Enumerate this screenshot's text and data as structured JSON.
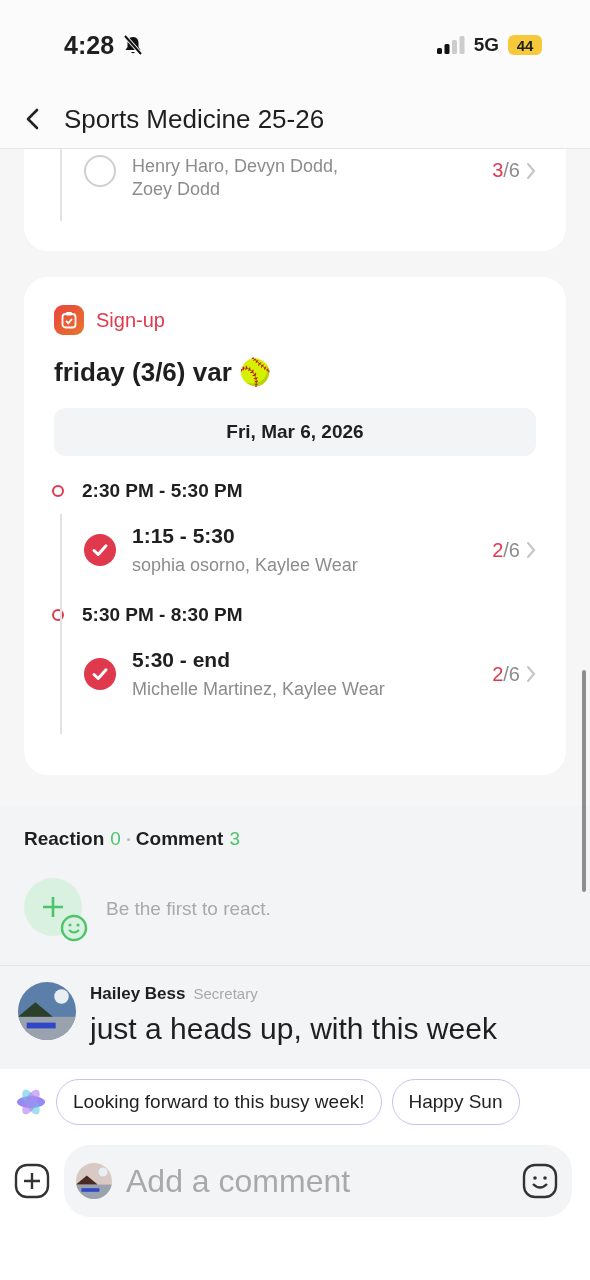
{
  "status_bar": {
    "time": "4:28",
    "network": "5G",
    "battery": "44"
  },
  "header": {
    "title": "Sports Medicine 25-26"
  },
  "previous_card": {
    "slots": [
      {
        "names": "Henry Haro, Devyn Dodd, Zoey Dodd",
        "filled": "3",
        "total": "/6",
        "checked": false
      }
    ]
  },
  "signup_card": {
    "label": "Sign-up",
    "title": "friday (3/6) var 🥎",
    "date": "Fri, Mar 6, 2026",
    "shifts": [
      {
        "time": "2:30 PM - 5:30 PM",
        "slots": [
          {
            "title": "1:15 - 5:30",
            "names": "sophia osorno, Kaylee Wear",
            "filled": "2",
            "total": "/6",
            "checked": true
          }
        ]
      },
      {
        "time": "5:30 PM - 8:30 PM",
        "slots": [
          {
            "title": "5:30 - end",
            "names": "Michelle Martinez, Kaylee Wear",
            "filled": "2",
            "total": "/6",
            "checked": true
          }
        ]
      }
    ]
  },
  "reactions": {
    "reaction_label": "Reaction",
    "reaction_count": "0",
    "comment_label": "Comment",
    "comment_count": "3",
    "prompt": "Be the first to react."
  },
  "comments": [
    {
      "author": "Hailey Bess",
      "role": "Secretary",
      "text": "just a heads up, with this week"
    }
  ],
  "suggestions": [
    "Looking forward to this busy week!",
    "Happy Sun"
  ],
  "composer": {
    "placeholder": "Add a comment"
  }
}
